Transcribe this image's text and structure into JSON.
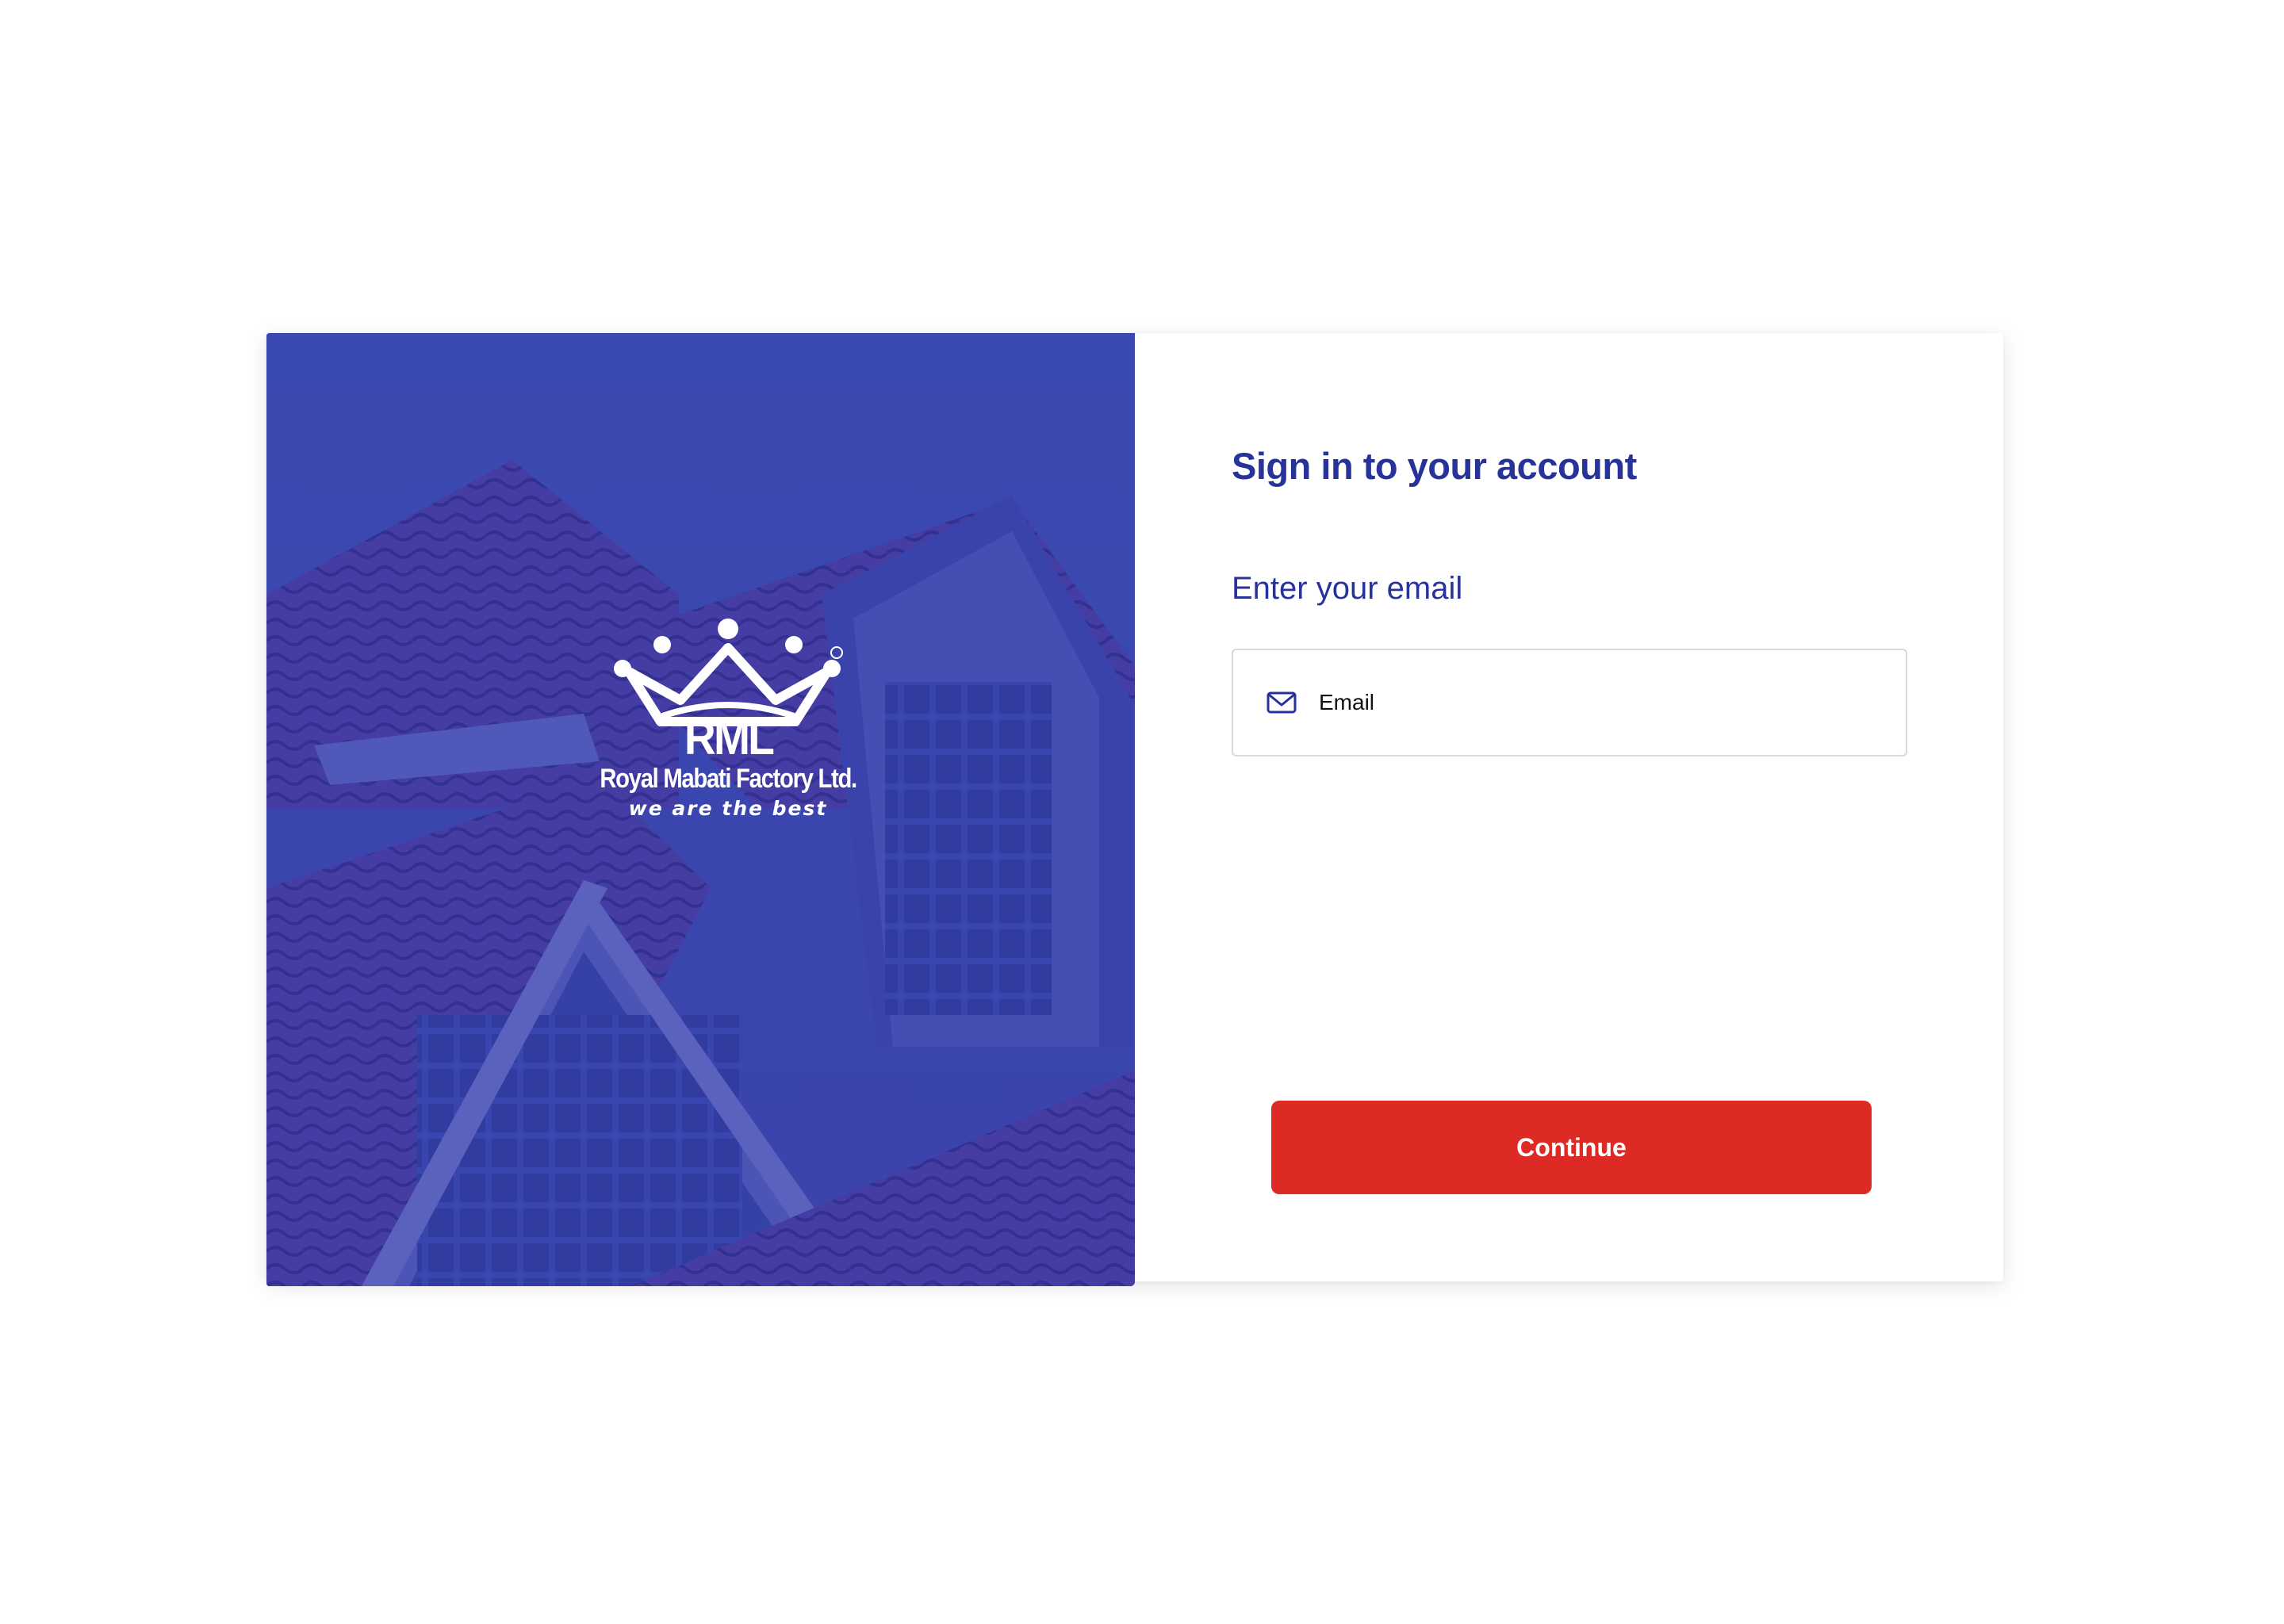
{
  "branding": {
    "logo_initials": "RML",
    "company_name": "Royal Mabati Factory Ltd.",
    "tagline": "we are the best",
    "registered_mark": "®",
    "hero_image": "house-roof-photo"
  },
  "form": {
    "title": "Sign in to your account",
    "email_label": "Enter your email",
    "email_value": "",
    "email_placeholder": "Email",
    "email_icon": "mail-icon",
    "continue_label": "Continue"
  },
  "colors": {
    "primary_blue": "#28339a",
    "hero_overlay": "#3b45a8",
    "accent_red": "#dd2a25",
    "background": "#ffffff",
    "input_border": "#d9d9dc"
  }
}
